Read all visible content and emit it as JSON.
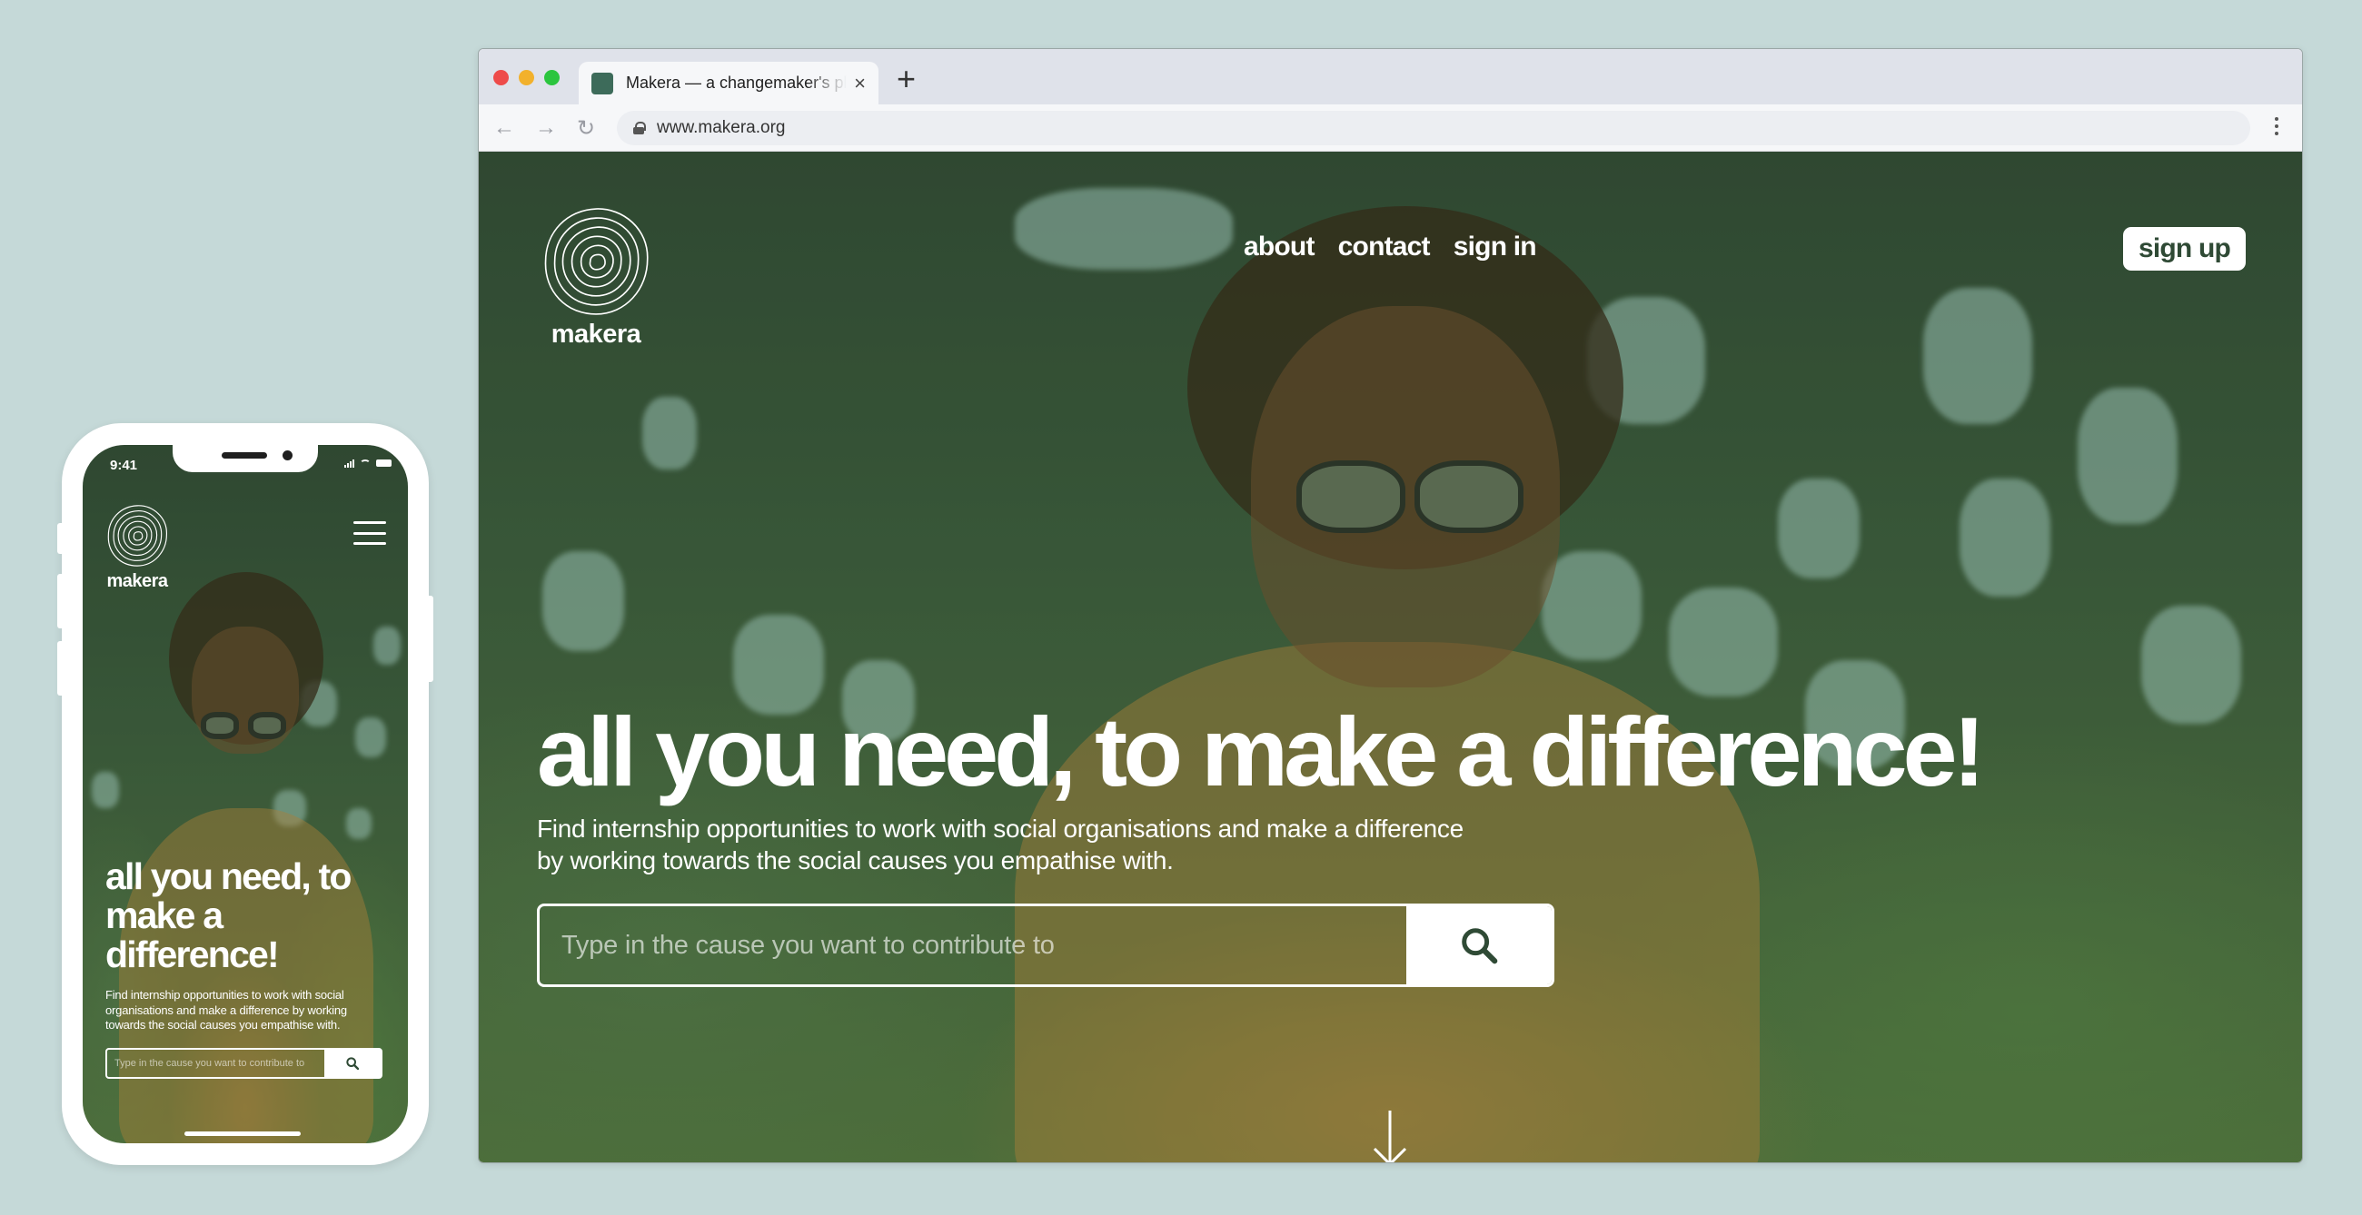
{
  "mobile": {
    "status_time": "9:41",
    "brand": "makera",
    "headline": "all you need, to make a difference!",
    "subtitle": "Find internship opportunities to work with social organisations and make a difference by working towards the social causes you empathise with.",
    "search_placeholder": "Type in the cause you want to contribute to",
    "menu_icon": "hamburger-icon",
    "search_icon": "search-icon"
  },
  "browser": {
    "tab_title": "Makera — a changemaker's playground",
    "url": "www.makera.org",
    "new_tab_label": "+",
    "close_tab_label": "×"
  },
  "site": {
    "brand": "makera",
    "nav": [
      {
        "label": "about"
      },
      {
        "label": "contact"
      },
      {
        "label": "sign in"
      }
    ],
    "signup_label": "sign up",
    "headline": "all you need, to make a difference!",
    "subtitle": "Find internship opportunities to work with social organisations and make a difference by working towards the social causes you empathise with.",
    "search_placeholder": "Type in the cause you want to contribute to",
    "search_icon": "search-icon",
    "scroll_icon": "arrow-down-icon"
  },
  "colors": {
    "page_background": "#c5d9d8",
    "brand_green": "#2f4a35",
    "hero_overlay": "#3c5a3c",
    "white": "#ffffff"
  }
}
